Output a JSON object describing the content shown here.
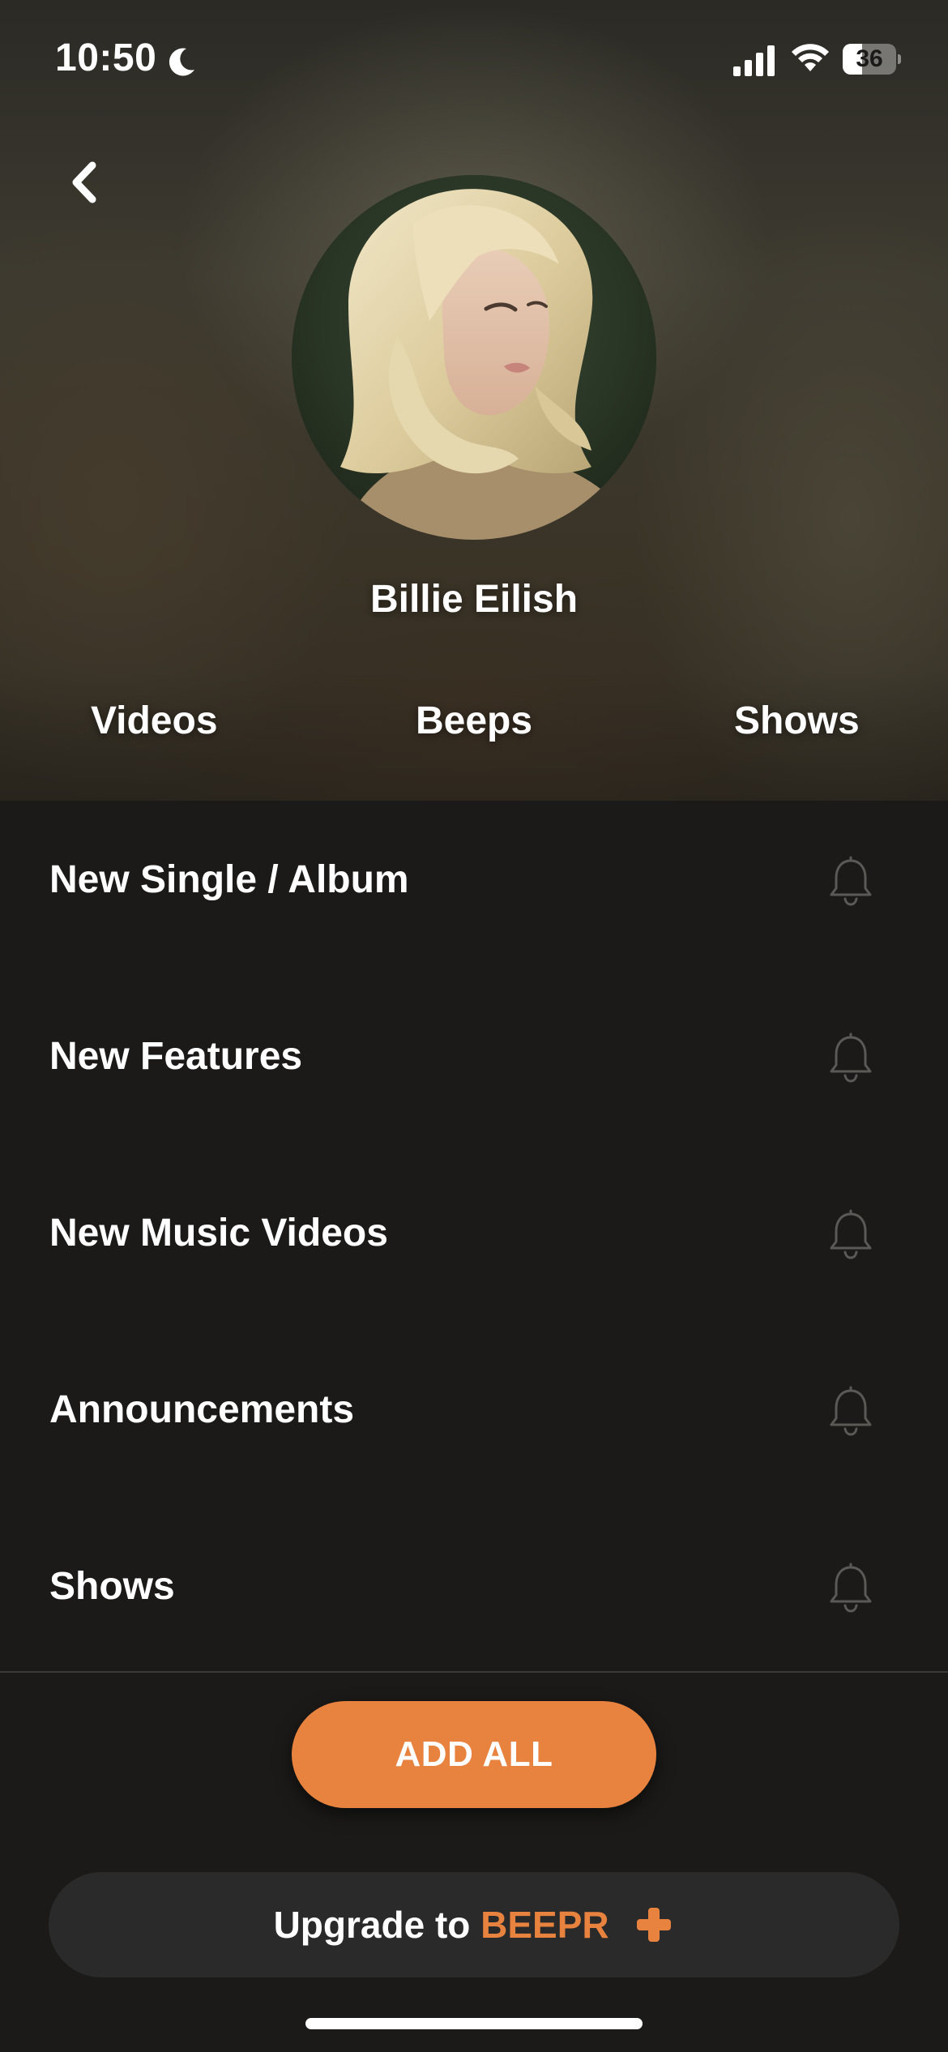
{
  "status_bar": {
    "time": "10:50",
    "battery_level": "36",
    "battery_fraction": 0.36,
    "icons": [
      "moon-icon",
      "signal-icon",
      "wifi-icon",
      "battery-icon"
    ]
  },
  "header": {
    "back_icon": "chevron-left-icon",
    "artist_name": "Billie Eilish",
    "tabs": [
      {
        "label": "Videos"
      },
      {
        "label": "Beeps"
      },
      {
        "label": "Shows"
      }
    ]
  },
  "notification_list": {
    "items": [
      {
        "label": "New Single / Album",
        "icon": "bell-icon"
      },
      {
        "label": "New Features",
        "icon": "bell-icon"
      },
      {
        "label": "New Music Videos",
        "icon": "bell-icon"
      },
      {
        "label": "Announcements",
        "icon": "bell-icon"
      },
      {
        "label": "Shows",
        "icon": "bell-icon"
      }
    ]
  },
  "actions": {
    "add_all_label": "ADD ALL"
  },
  "upgrade": {
    "prefix": "Upgrade to",
    "brand": "BEEPR",
    "icon": "plus-icon"
  },
  "colors": {
    "accent": "#e8823f",
    "background": "#1b1a19",
    "upgrade_bar": "#2a2a2a"
  }
}
